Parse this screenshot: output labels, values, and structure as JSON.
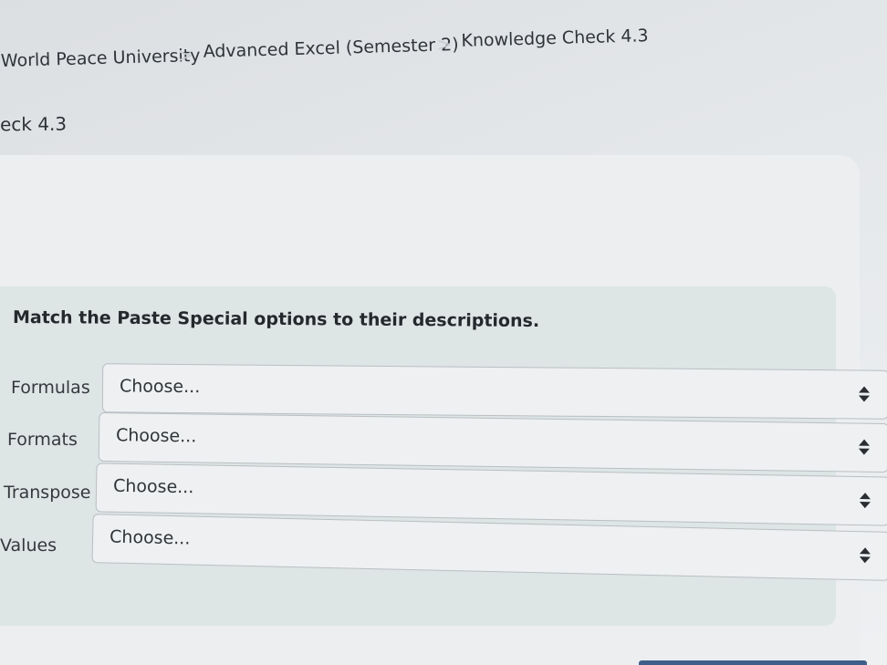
{
  "breadcrumb": {
    "items": [
      "World Peace University",
      "Advanced Excel (Semester 2)",
      "Knowledge Check 4.3"
    ],
    "separator": ">"
  },
  "page_title": "eck 4.3",
  "question": {
    "prompt": "Match the Paste Special options to their descriptions.",
    "rows": [
      {
        "label": "Formulas",
        "select_value": "Choose..."
      },
      {
        "label": "Formats",
        "select_value": "Choose..."
      },
      {
        "label": "Transpose",
        "select_value": "Choose..."
      },
      {
        "label": "Values",
        "select_value": "Choose..."
      }
    ]
  },
  "icons": {
    "breadcrumb_separator": "chevron-right-icon",
    "select_arrows": "updown-arrows-icon"
  },
  "colors": {
    "question_background": "#dde5e5",
    "card_background": "#eceef0",
    "accent": "#3d5f8a"
  }
}
